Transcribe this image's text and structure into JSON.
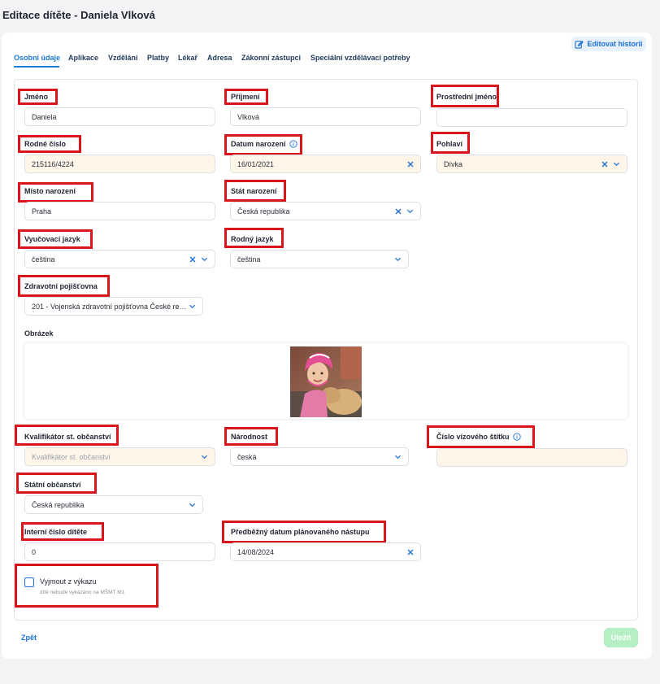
{
  "page": {
    "title": "Editace dítěte - Daniela Vlková"
  },
  "header": {
    "history_button": "Editovat historii"
  },
  "tabs": [
    {
      "label": "Osobní údaje"
    },
    {
      "label": "Aplikace"
    },
    {
      "label": "Vzdělání"
    },
    {
      "label": "Platby"
    },
    {
      "label": "Lékař"
    },
    {
      "label": "Adresa"
    },
    {
      "label": "Zákonní zástupci"
    },
    {
      "label": "Speciální vzdělávací potřeby"
    }
  ],
  "fields": {
    "jmeno": {
      "label": "Jméno",
      "value": "Daniela"
    },
    "prijmeni": {
      "label": "Příjmení",
      "value": "Vlková"
    },
    "prostredni_jmeno": {
      "label": "Prostřední jméno",
      "value": ""
    },
    "rodne_cislo": {
      "label": "Rodné číslo",
      "value": "215116/4224"
    },
    "datum_narozeni": {
      "label": "Datum narození",
      "value": "16/01/2021"
    },
    "pohlavi": {
      "label": "Pohlaví",
      "value": "Dívka"
    },
    "misto_narozeni": {
      "label": "Místo narození",
      "value": "Praha"
    },
    "stat_narozeni": {
      "label": "Stát narození",
      "value": "Česká republika"
    },
    "vyucovaci_jazyk": {
      "label": "Vyučovací jazyk",
      "value": "čeština"
    },
    "rodny_jazyk": {
      "label": "Rodný jazyk",
      "value": "čeština"
    },
    "zdravotni_pojistovna": {
      "label": "Zdravotní pojišťovna",
      "value": "201 - Vojenská zdravotní pojišťovna České rep..."
    },
    "obrazek": {
      "label": "Obrázek"
    },
    "kvalifikator": {
      "label": "Kvalifikátor st. občanství",
      "placeholder": "Kvalifikátor st. občanství"
    },
    "narodnost": {
      "label": "Národnost",
      "value": "česká"
    },
    "vizovy_stitek": {
      "label": "Číslo vízového štítku",
      "value": ""
    },
    "statni_obcanstvi": {
      "label": "Státní občanství",
      "value": "Česká republika"
    },
    "interni_cislo": {
      "label": "Interní číslo dítěte",
      "value": "0"
    },
    "datum_nastupu": {
      "label": "Předběžný datum plánovaného nástupu",
      "value": "14/08/2024"
    }
  },
  "exclude": {
    "label": "Vyjmout z výkazu",
    "note": "dítě nebude vykázáno na MŠMT M1",
    "checked": false
  },
  "footer": {
    "back": "Zpět",
    "save": "Uložit"
  },
  "colors": {
    "accent": "#1d6fd6",
    "highlight": "#d9141b",
    "warm_field": "#fff6e9",
    "save_bg": "#b7efc4"
  }
}
